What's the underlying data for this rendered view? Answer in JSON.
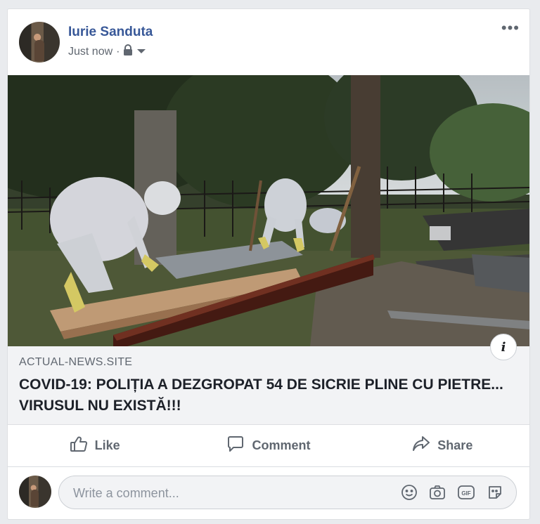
{
  "post": {
    "author": "Iurie Sanduta",
    "timestamp": "Just now",
    "separator": "·",
    "privacy_icon": "lock-icon",
    "more_label": "•••"
  },
  "link": {
    "domain": "ACTUAL-NEWS.SITE",
    "headline": "COVID-19: POLIȚIA A DEZGROPAT 54 DE SICRIE PLINE CU PIETRE... VIRUSUL NU EXISTĂ!!!",
    "info_label": "i"
  },
  "actions": {
    "like": "Like",
    "comment": "Comment",
    "share": "Share"
  },
  "composer": {
    "placeholder": "Write a comment...",
    "icons": [
      "smiley-icon",
      "camera-icon",
      "gif-icon",
      "sticker-icon"
    ]
  },
  "colors": {
    "author": "#385898",
    "muted": "#606770",
    "background": "#e9ebee"
  }
}
